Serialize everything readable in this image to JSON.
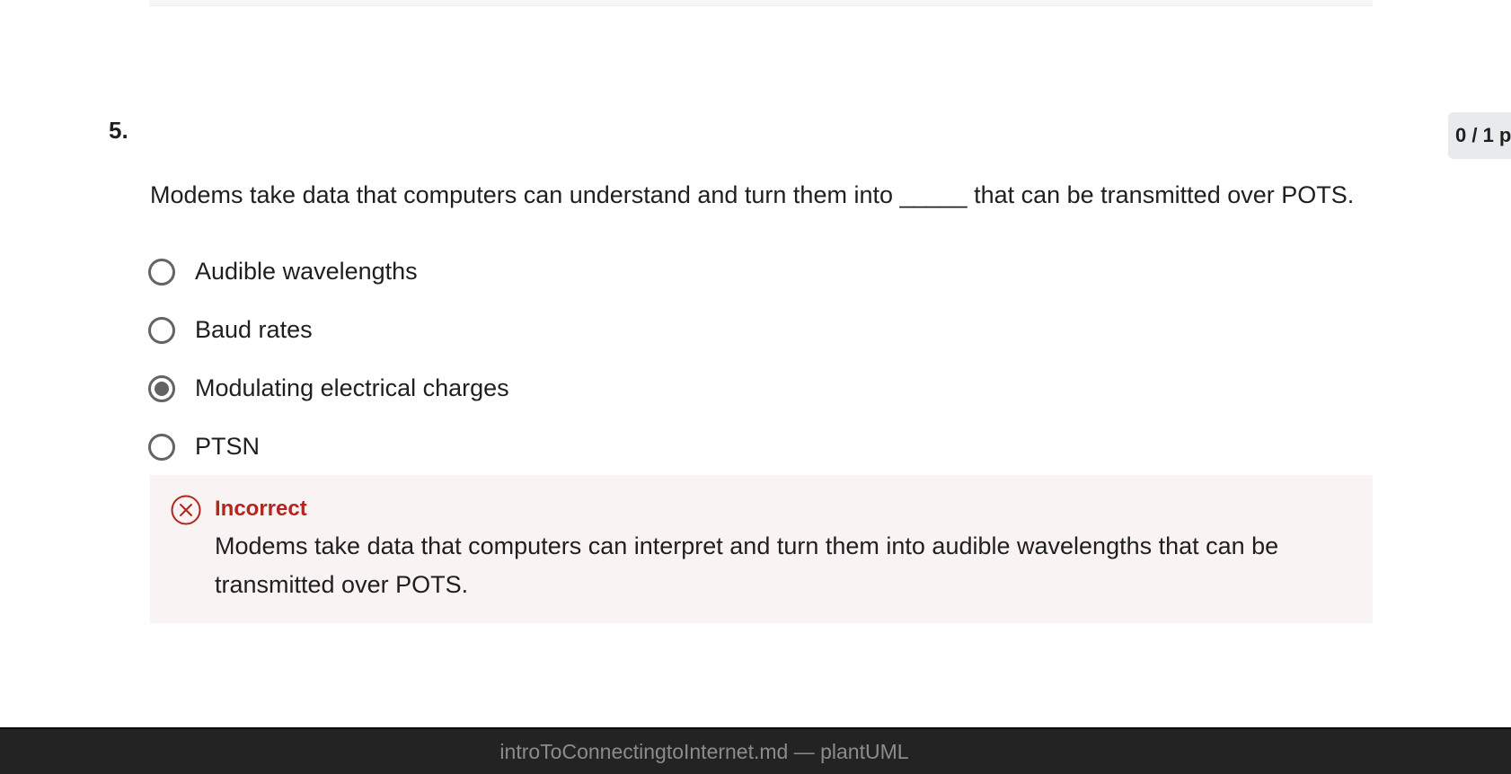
{
  "question": {
    "number": "5.",
    "points": "0 / 1 p",
    "text": "Modems take data that computers can understand and turn them into _____ that can be transmitted over POTS.",
    "options": [
      {
        "label": "Audible wavelengths",
        "selected": false
      },
      {
        "label": "Baud rates",
        "selected": false
      },
      {
        "label": "Modulating electrical charges",
        "selected": true
      },
      {
        "label": "PTSN",
        "selected": false
      }
    ]
  },
  "feedback": {
    "status": "Incorrect",
    "icon": "x-circle-icon",
    "message": "Modems take data that computers can interpret and turn them into audible wavelengths that can be transmitted over POTS.",
    "color": "#b3261e",
    "background": "#f9f3f3"
  },
  "window": {
    "title": "introToConnectingtoInternet.md — plantUML"
  }
}
